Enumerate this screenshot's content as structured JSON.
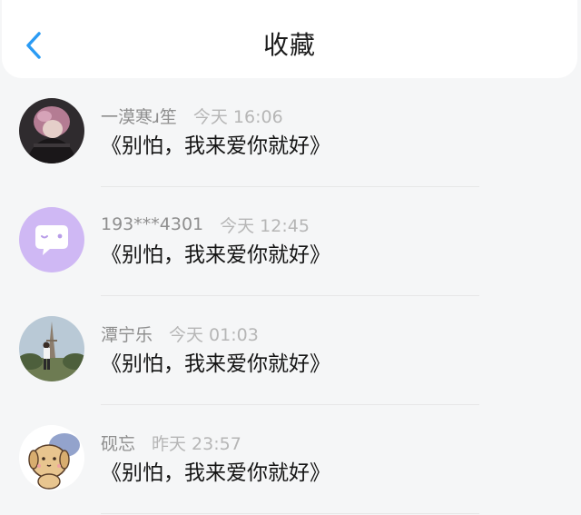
{
  "header": {
    "title": "收藏",
    "back_icon": "chevron-left-icon"
  },
  "colors": {
    "accent": "#2a9bf4",
    "name_text": "#8e8e8e",
    "time_text": "#b6b6b6"
  },
  "favorites": [
    {
      "name": "一漠寒ɹ笙",
      "time": "今天 16:06",
      "content": "《别怕，我来爱你就好》"
    },
    {
      "name": "193***4301",
      "time": "今天 12:45",
      "content": "《别怕，我来爱你就好》"
    },
    {
      "name": "潭宁乐",
      "time": "今天 01:03",
      "content": "《别怕，我来爱你就好》"
    },
    {
      "name": "砚忘",
      "time": "昨天 23:57",
      "content": "《别怕，我来爱你就好》"
    }
  ]
}
